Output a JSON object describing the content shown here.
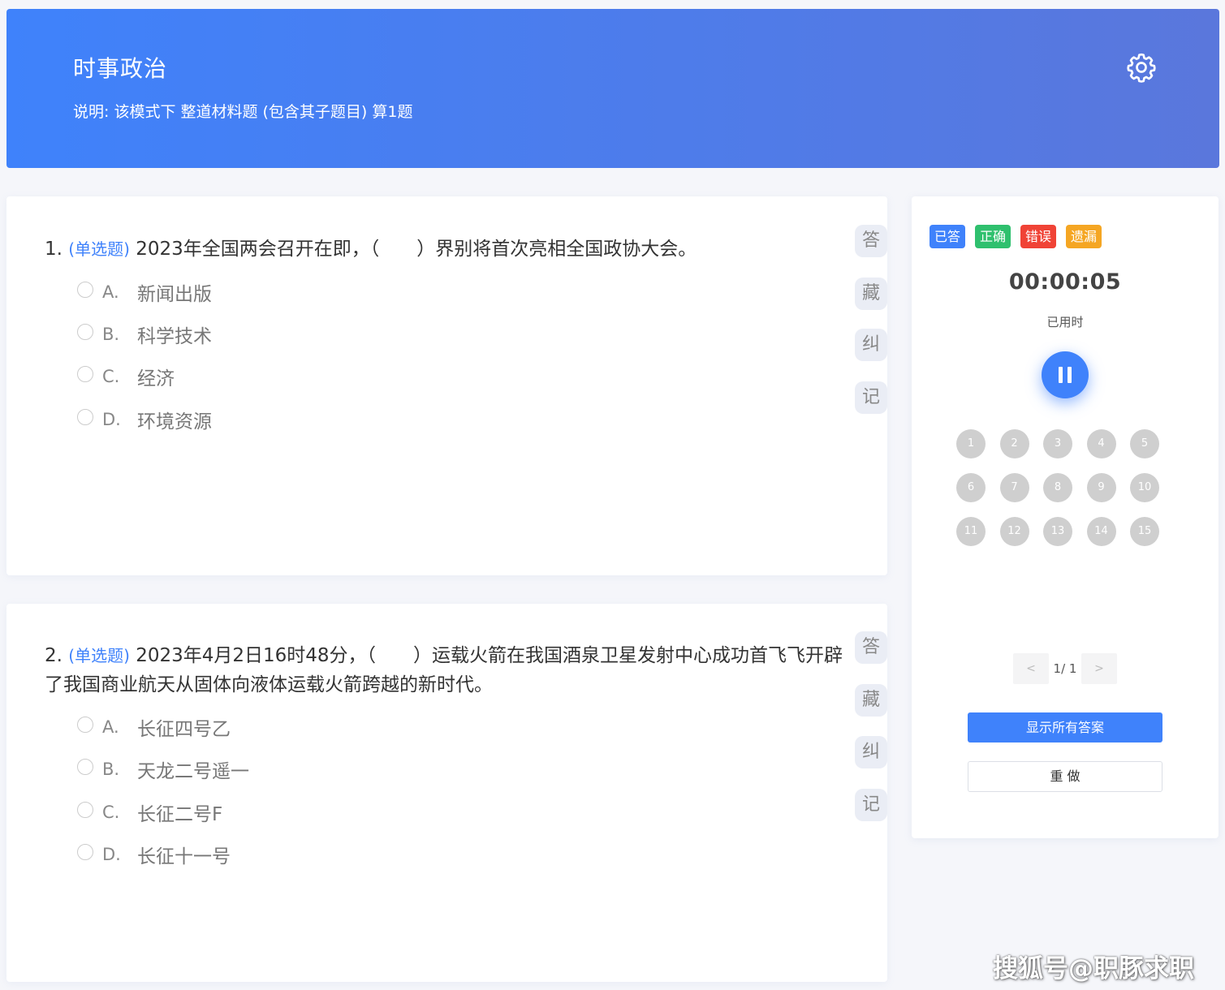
{
  "header": {
    "title": "时事政治",
    "description": "说明:  该模式下 整道材料题 (包含其子题目) 算1题",
    "settings_icon": "gear-icon"
  },
  "questions": [
    {
      "number": "1.",
      "type": "(单选题)",
      "text": "2023年全国两会召开在即，（　　）界别将首次亮相全国政协大会。",
      "options": [
        {
          "letter": "A.",
          "text": "新闻出版"
        },
        {
          "letter": "B.",
          "text": "科学技术"
        },
        {
          "letter": "C.",
          "text": "经济"
        },
        {
          "letter": "D.",
          "text": "环境资源"
        }
      ],
      "side_actions": [
        "答",
        "藏",
        "纠",
        "记"
      ]
    },
    {
      "number": "2.",
      "type": "(单选题)",
      "text": "2023年4月2日16时48分，（　　）运载火箭在我国酒泉卫星发射中心成功首飞飞开辟了我国商业航天从固体向液体运载火箭跨越的新时代。",
      "options": [
        {
          "letter": "A.",
          "text": "长征四号乙"
        },
        {
          "letter": "B.",
          "text": "天龙二号遥一"
        },
        {
          "letter": "C.",
          "text": "长征二号F"
        },
        {
          "letter": "D.",
          "text": "长征十一号"
        }
      ],
      "side_actions": [
        "答",
        "藏",
        "纠",
        "记"
      ]
    }
  ],
  "panel": {
    "legend": [
      {
        "label": "已答",
        "color": "#3f82fb"
      },
      {
        "label": "正确",
        "color": "#2fc06e"
      },
      {
        "label": "错误",
        "color": "#f04336"
      },
      {
        "label": "遗漏",
        "color": "#f5a623"
      }
    ],
    "timer": "00:00:05",
    "timer_label": "已用时",
    "pause_icon": "pause-icon",
    "numbers": [
      "1",
      "2",
      "3",
      "4",
      "5",
      "6",
      "7",
      "8",
      "9",
      "10",
      "11",
      "12",
      "13",
      "14",
      "15"
    ],
    "pager": {
      "prev": "<",
      "text": "1/ 1",
      "next": ">"
    },
    "show_answers_label": "显示所有答案",
    "redo_label": "重 做"
  },
  "watermark": "搜狐号@职豚求职"
}
